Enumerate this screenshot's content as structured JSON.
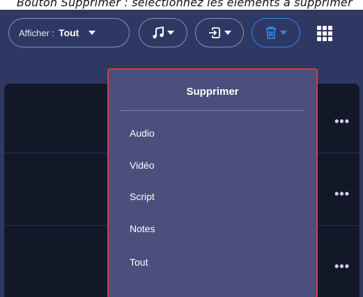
{
  "caption": "Bouton Supprimer : sélectionnez les éléments à supprimer",
  "toolbar": {
    "filter_label": "Afficher :",
    "filter_value": "Tout",
    "music_icon": "music-note-icon",
    "export_icon": "export-icon",
    "delete_icon": "trash-icon",
    "apps_icon": "grid-icon"
  },
  "colors": {
    "background": "#2f3763",
    "menu": "#4a4f7e",
    "highlight_border": "#e0383c",
    "accent": "#2d8de9",
    "list": "#131829"
  },
  "list": {
    "more_label": "•••"
  },
  "delete_menu": {
    "title": "Supprimer",
    "items": [
      "Audio",
      "Vidéo",
      "Script",
      "Notes",
      "Tout"
    ]
  }
}
